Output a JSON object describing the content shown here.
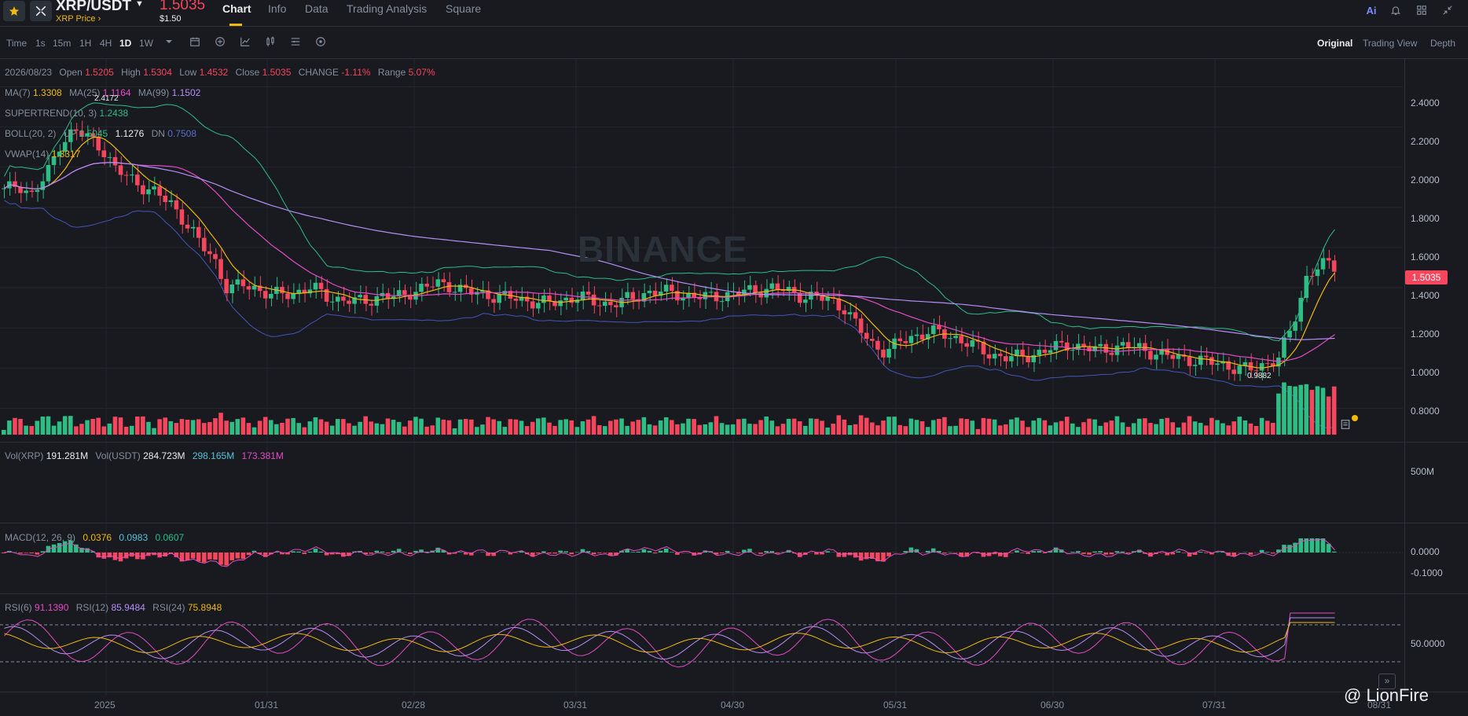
{
  "header": {
    "symbol": "XRP/USDT",
    "subtitle": "XRP Price ›",
    "last_price": "1.5035",
    "usd_price": "$1.50",
    "tabs": [
      "Chart",
      "Info",
      "Data",
      "Trading Analysis",
      "Square"
    ],
    "active_tab": "Chart",
    "ai_label": "Ai"
  },
  "toolbar": {
    "timeframes": [
      "Time",
      "1s",
      "15m",
      "1H",
      "4H",
      "1D",
      "1W"
    ],
    "active_timeframe": "1D",
    "views": [
      "Original",
      "Trading View",
      "Depth"
    ],
    "active_view": "Original"
  },
  "ohlc": {
    "date": "2026/08/23",
    "open_label": "Open",
    "open": "1.5205",
    "high_label": "High",
    "high": "1.5304",
    "low_label": "Low",
    "low": "1.4532",
    "close_label": "Close",
    "close": "1.5035",
    "change_label": "CHANGE",
    "change": "-1.11%",
    "range_label": "Range",
    "range": "5.07%"
  },
  "indicators": {
    "ma": {
      "ma7_label": "MA(7)",
      "ma7": "1.3308",
      "ma25_label": "MA(25)",
      "ma25": "1.1164",
      "ma99_label": "MA(99)",
      "ma99": "1.1502"
    },
    "supertrend": {
      "label": "SUPERTREND(10, 3)",
      "value": "1.2438"
    },
    "boll": {
      "label": "BOLL(20, 2)",
      "up_label": "UP",
      "up": "1.5045",
      "mb": "1.1276",
      "dn_label": "DN",
      "dn": "0.7508"
    },
    "vwap": {
      "label": "VWAP(14)",
      "value": "1.3317"
    },
    "vol": {
      "xrp_label": "Vol(XRP)",
      "xrp": "191.281M",
      "usdt_label": "Vol(USDT)",
      "usdt": "284.723M",
      "ma1": "298.165M",
      "ma2": "173.381M"
    },
    "macd": {
      "label": "MACD(12, 26, 9)",
      "dif": "0.0376",
      "dea": "0.0983",
      "hist": "0.0607"
    },
    "rsi": {
      "rsi6_label": "RSI(6)",
      "rsi6": "91.1390",
      "rsi12_label": "RSI(12)",
      "rsi12": "85.9484",
      "rsi24_label": "RSI(24)",
      "rsi24": "75.8948"
    }
  },
  "price_axis": [
    "2.4000",
    "2.2000",
    "2.0000",
    "1.8000",
    "1.6000",
    "1.4000",
    "1.2000",
    "1.0000",
    "0.8000"
  ],
  "volume_axis": [
    "500M"
  ],
  "macd_axis": [
    "0.0000",
    "-0.1000"
  ],
  "rsi_axis": [
    "50.0000"
  ],
  "date_axis": [
    "2025",
    "01/31",
    "02/28",
    "03/31",
    "04/30",
    "05/31",
    "06/30",
    "07/31",
    "08/31"
  ],
  "markers": {
    "high": "2.4172",
    "low": "0.9882"
  },
  "current_price_tag": "1.5035",
  "watermark": "BINANCE",
  "credit": "@ LionFire",
  "colors": {
    "up": "#2ebd85",
    "down": "#f6465d",
    "accent": "#f0b90b",
    "bg": "#181a20"
  },
  "chart_data": {
    "type": "candlestick",
    "close_series": [
      1.88,
      1.92,
      1.86,
      1.95,
      2.12,
      2.18,
      2.15,
      2.1,
      1.98,
      1.95,
      1.9,
      1.86,
      1.82,
      1.72,
      1.62,
      1.55,
      1.38,
      1.42,
      1.4,
      1.36,
      1.37,
      1.38,
      1.4,
      1.36,
      1.34,
      1.33,
      1.34,
      1.36,
      1.35,
      1.38,
      1.4,
      1.42,
      1.41,
      1.38,
      1.37,
      1.36,
      1.35,
      1.34,
      1.33,
      1.32,
      1.34,
      1.36,
      1.33,
      1.32,
      1.33,
      1.35,
      1.38,
      1.38,
      1.37,
      1.36,
      1.35,
      1.36,
      1.37,
      1.38,
      1.39,
      1.4,
      1.38,
      1.36,
      1.35,
      1.34,
      1.3,
      1.2,
      1.12,
      1.08,
      1.13,
      1.16,
      1.18,
      1.17,
      1.15,
      1.12,
      1.08,
      1.06,
      1.05,
      1.06,
      1.08,
      1.1,
      1.12,
      1.1,
      1.09,
      1.1,
      1.11,
      1.1,
      1.08,
      1.06,
      1.05,
      1.04,
      1.03,
      1.02,
      1.0,
      0.99,
      1.02,
      1.05,
      1.2,
      1.45,
      1.52,
      1.5
    ],
    "ylim": [
      0.7,
      2.5
    ],
    "x_ticks": [
      "2025",
      "01/31",
      "02/28",
      "03/31",
      "04/30",
      "05/31",
      "06/30",
      "07/31",
      "08/31"
    ]
  }
}
